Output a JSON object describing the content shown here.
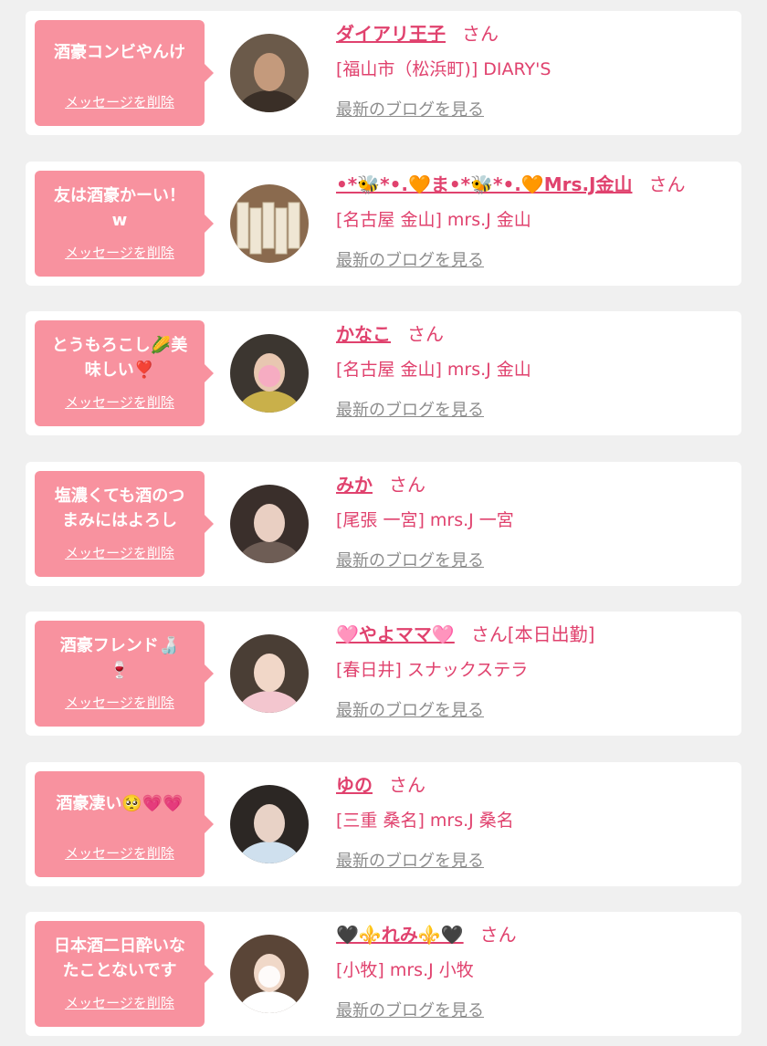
{
  "delete_label": "メッセージを削除",
  "blog_label": "最新のブログを見る",
  "colors": {
    "background": "#f0f0f0",
    "card": "#ffffff",
    "bubble": "#f8929f",
    "accent": "#e0426e",
    "link_gray": "#8c8c8c"
  },
  "messages": [
    {
      "bubble_text": "酒豪コンビやんけ",
      "name": "ダイアリ王子",
      "suffix": "さん",
      "shop": "[福山市（松浜町)] DIARY'S",
      "avatar": "avatar-man-photo"
    },
    {
      "bubble_text": "友は酒豪かーい！\nw",
      "name": "•*🐝*•.🧡ま•*🐝*•.🧡Mrs.J金山",
      "suffix": "さん",
      "shop": "[名古屋 金山] mrs.J 金山",
      "avatar": "avatar-sake-bottles-photo"
    },
    {
      "bubble_text": "とうもろこし🌽美\n味しい❣️",
      "name": "かなこ",
      "suffix": "さん",
      "shop": "[名古屋 金山] mrs.J 金山",
      "avatar": "avatar-woman-photo"
    },
    {
      "bubble_text": "塩濃くても酒のつ\nまみにはよろし",
      "name": "みか",
      "suffix": "さん",
      "shop": "[尾張 一宮] mrs.J 一宮",
      "avatar": "avatar-woman-photo"
    },
    {
      "bubble_text": "酒豪フレンド🍶\n🍷",
      "name": "🩷やよママ🩷",
      "suffix": "さん[本日出勤]",
      "shop": "[春日井] スナックステラ",
      "avatar": "avatar-woman-flowers-photo"
    },
    {
      "bubble_text": "酒豪凄い🥺💗💗",
      "name": "ゆの",
      "suffix": "さん",
      "shop": "[三重 桑名] mrs.J 桑名",
      "avatar": "avatar-woman-photo"
    },
    {
      "bubble_text": "日本酒二日酔いな\nたことないです",
      "name": "🖤⚜️れみ⚜️🖤",
      "suffix": "さん",
      "shop": "[小牧] mrs.J 小牧",
      "avatar": "avatar-woman-photo"
    }
  ]
}
